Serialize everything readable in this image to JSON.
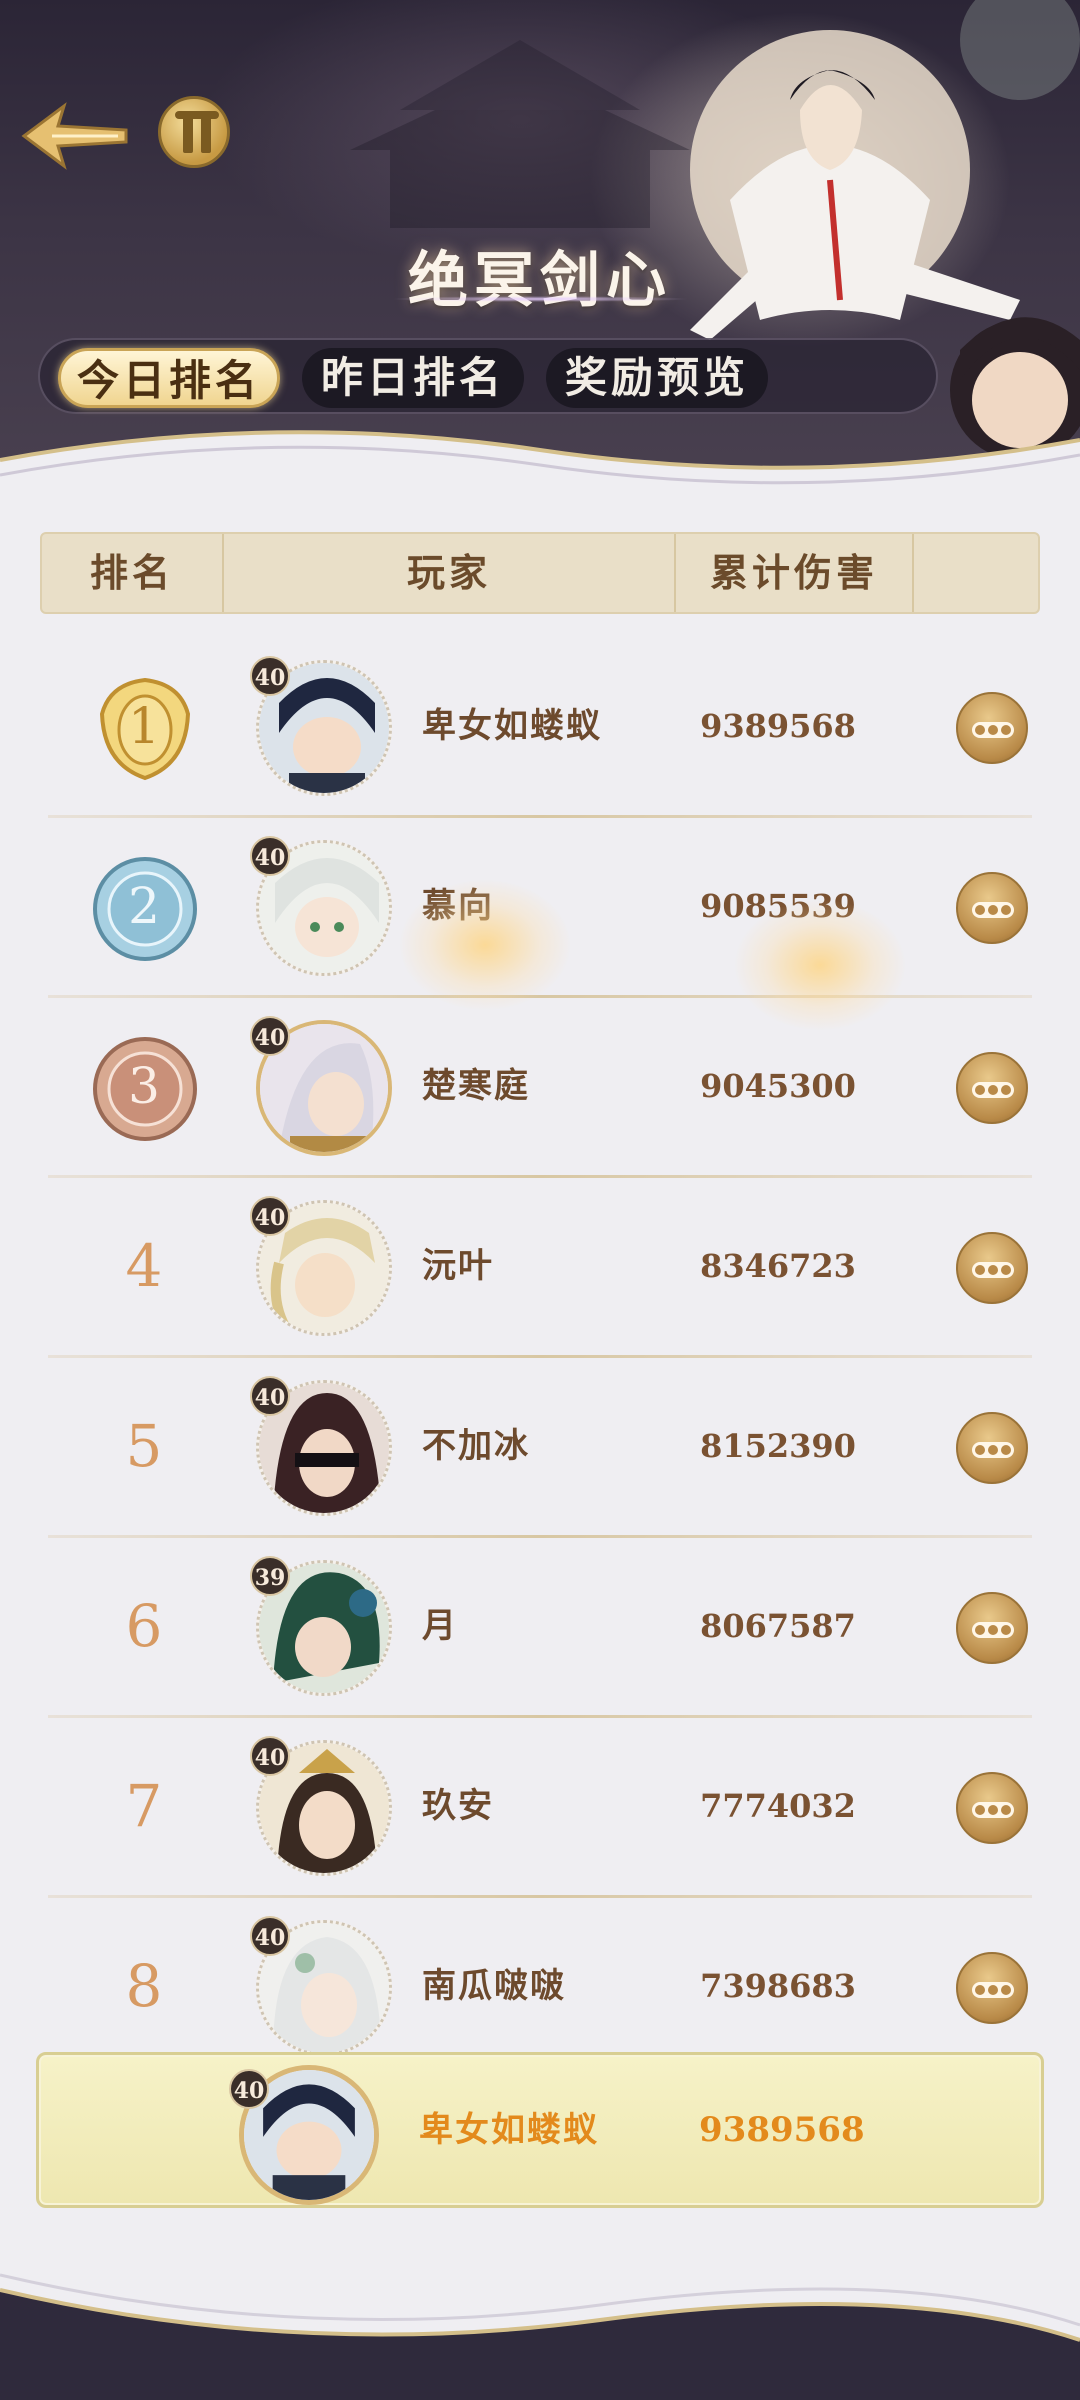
{
  "header": {
    "title": "绝冥剑心",
    "back_icon": "back-arrow-icon",
    "shop_icon": "shop-pavilion-icon"
  },
  "tabs": [
    {
      "label": "今日排名",
      "active": true
    },
    {
      "label": "昨日排名",
      "active": false
    },
    {
      "label": "奖励预览",
      "active": false
    }
  ],
  "table": {
    "columns": [
      "排名",
      "玩家",
      "累计伤害",
      ""
    ],
    "rows": [
      {
        "rank": "1",
        "medal": "gold",
        "level": "40",
        "name": "卑女如蝼蚁",
        "damage": "9389568"
      },
      {
        "rank": "2",
        "medal": "silver",
        "level": "40",
        "name": "慕向",
        "damage": "9085539"
      },
      {
        "rank": "3",
        "medal": "bronze",
        "level": "40",
        "name": "楚寒庭",
        "damage": "9045300"
      },
      {
        "rank": "4",
        "medal": "",
        "level": "40",
        "name": "沅叶",
        "damage": "8346723"
      },
      {
        "rank": "5",
        "medal": "",
        "level": "40",
        "name": "不加冰",
        "damage": "8152390"
      },
      {
        "rank": "6",
        "medal": "",
        "level": "39",
        "name": "月",
        "damage": "8067587"
      },
      {
        "rank": "7",
        "medal": "",
        "level": "40",
        "name": "玖安",
        "damage": "7774032"
      },
      {
        "rank": "8",
        "medal": "",
        "level": "40",
        "name": "南瓜啵啵",
        "damage": "7398683"
      }
    ]
  },
  "my_rank": {
    "level": "40",
    "name": "卑女如蝼蚁",
    "damage": "9389568"
  },
  "colors": {
    "accent_gold": "#c9a456",
    "rank_text": "#d79a63",
    "my_highlight": "#e38a1c",
    "header_bg": "#2b2536"
  }
}
